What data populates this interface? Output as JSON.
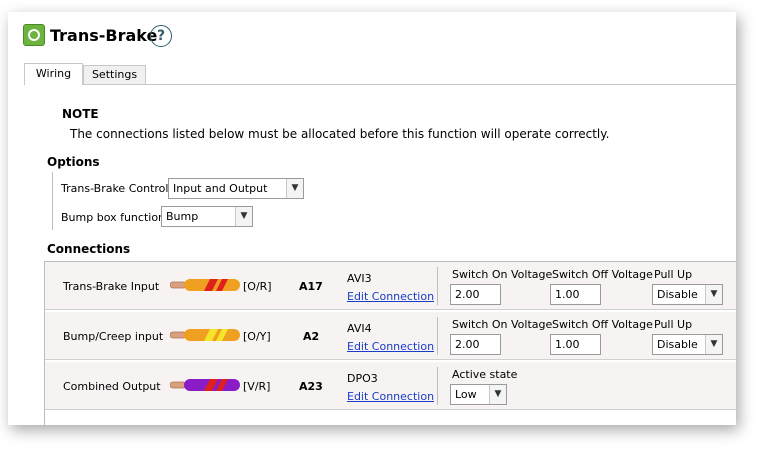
{
  "title": "Trans-Brake",
  "tabs": [
    {
      "label": "Wiring"
    },
    {
      "label": "Settings"
    }
  ],
  "note": {
    "title": "NOTE",
    "text": "The connections listed below must be allocated before this function will operate correctly."
  },
  "options": {
    "title": "Options",
    "transbrake_control": {
      "label": "Trans-Brake Control",
      "value": "Input and Output"
    },
    "bump_box": {
      "label": "Bump box function",
      "value": "Bump"
    }
  },
  "connections": {
    "title": "Connections",
    "rows": [
      {
        "name": "Trans-Brake Input",
        "wire_code": "[O/R]",
        "pin": "A17",
        "io": "AVI3",
        "edit_label": "Edit Connection",
        "switch_on_label": "Switch On Voltage",
        "switch_on_value": "2.00",
        "switch_off_label": "Switch Off Voltage",
        "switch_off_value": "1.00",
        "pullup_label": "Pull Up",
        "pullup_value": "Disable",
        "wire_base": "#f0a020",
        "wire_stripe": "#e0201c"
      },
      {
        "name": "Bump/Creep input",
        "wire_code": "[O/Y]",
        "pin": "A2",
        "io": "AVI4",
        "edit_label": "Edit Connection",
        "switch_on_label": "Switch On Voltage",
        "switch_on_value": "2.00",
        "switch_off_label": "Switch Off Voltage",
        "switch_off_value": "1.00",
        "pullup_label": "Pull Up",
        "pullup_value": "Disable",
        "wire_base": "#f0a020",
        "wire_stripe": "#f5e62a"
      },
      {
        "name": "Combined Output",
        "wire_code": "[V/R]",
        "pin": "A23",
        "io": "DPO3",
        "edit_label": "Edit Connection",
        "active_state_label": "Active state",
        "active_state_value": "Low",
        "wire_base": "#8a1cc8",
        "wire_stripe": "#e0201c"
      }
    ]
  },
  "colors": {
    "link": "#1a3cc8",
    "app_icon": "#6cb33f",
    "row_bg": "#f7f3f2"
  }
}
